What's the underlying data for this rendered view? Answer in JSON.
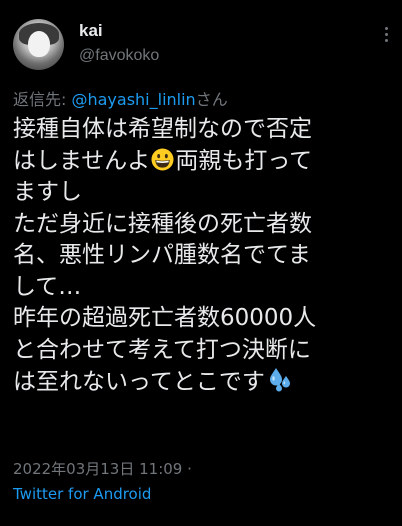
{
  "user": {
    "display_name": "kai",
    "handle": "@favokoko"
  },
  "reply": {
    "prefix": "返信先: ",
    "to": "@hayashi_linlin",
    "suffix": "さん"
  },
  "tweet": {
    "line1": "接種自体は希望制なので否定",
    "line2_before": "はしませんよ",
    "line2_after": "両親も打って",
    "line3": "ますし",
    "line4": "ただ身近に接種後の死亡者数",
    "line5": "名、悪性リンパ腫数名でてま",
    "line6": "して…",
    "line7": "昨年の超過死亡者数60000人",
    "line8": "と合わせて考えて打つ決断に",
    "line9_text": "は至れないってとこです",
    "emoji_1": "grinning-face",
    "emoji_2": "sweat-droplets"
  },
  "meta": {
    "timestamp": "2022年03月13日 11:09 ·",
    "source": "Twitter for Android"
  },
  "colors": {
    "background": "#000000",
    "text": "#e7e9ea",
    "secondary": "#71767b",
    "link": "#1d9bf0"
  }
}
